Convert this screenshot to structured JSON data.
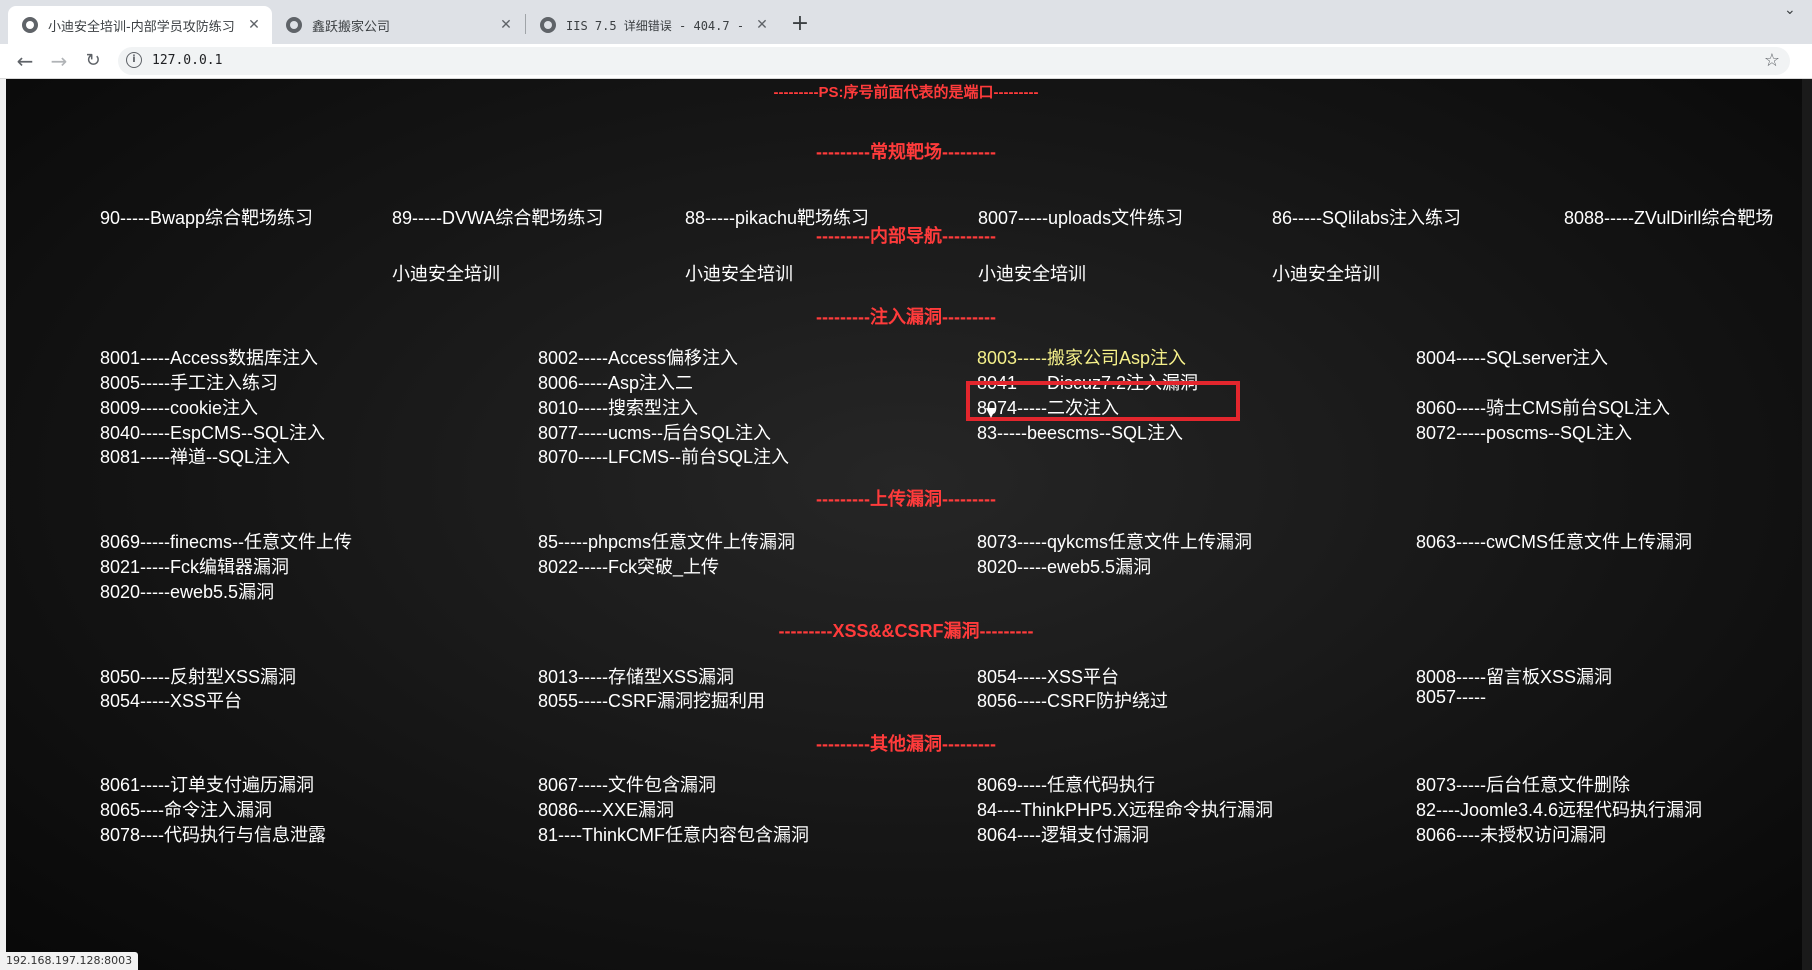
{
  "browser": {
    "tabs": [
      {
        "title": "小迪安全培训-内部学员攻防练习",
        "active": true
      },
      {
        "title": "鑫跃搬家公司",
        "active": false
      },
      {
        "title": "IIS 7.5 详细错误 - 404.7 - Not Found",
        "active": false
      }
    ],
    "new_tab_label": "+",
    "url": "127.0.0.1",
    "status_url": "192.168.197.128:8003",
    "icons": {
      "back": "arrow-left-icon",
      "forward": "arrow-right-icon",
      "reload": "reload-icon",
      "info": "info-icon",
      "bookmark": "star-icon"
    }
  },
  "page": {
    "ps_note": "---------PS:序号前面代表的是端口---------",
    "sections": [
      {
        "title": "---------常规靶场---------",
        "items": [
          "90-----Bwapp综合靶场练习",
          "89-----DVWA综合靶场练习",
          "88-----pikachu靶场练习",
          "8007-----uploads文件练习",
          "86-----SQlilabs注入练习",
          "8088-----ZVulDirll综合靶场"
        ]
      },
      {
        "title": "---------内部导航---------",
        "items": [
          "小迪安全培训",
          "小迪安全培训",
          "小迪安全培训",
          "小迪安全培训"
        ]
      },
      {
        "title": "---------注入漏洞---------",
        "rows": [
          [
            "8001-----Access数据库注入",
            "8002-----Access偏移注入",
            "8003-----搬家公司Asp注入",
            "8004-----SQLserver注入"
          ],
          [
            "8005-----手工注入练习",
            "8006-----Asp注入二",
            "8041-----Discuz7.2注入漏洞"
          ],
          [
            "8009-----cookie注入",
            "8010-----搜索型注入",
            "8074-----二次注入",
            "8060-----骑士CMS前台SQL注入"
          ],
          [
            "8040-----EspCMS--SQL注入",
            "8077-----ucms--后台SQL注入",
            "83-----beescms--SQL注入",
            "8072-----poscms--SQL注入"
          ],
          [
            "8081-----禅道--SQL注入",
            "8070-----LFCMS--前台SQL注入"
          ]
        ]
      },
      {
        "title": "---------上传漏洞---------",
        "rows": [
          [
            "8069-----finecms--任意文件上传",
            "85-----phpcms任意文件上传漏洞",
            "8073-----qykcms任意文件上传漏洞",
            "8063-----cwCMS任意文件上传漏洞"
          ],
          [
            "8021-----Fck编辑器漏洞",
            "8022-----Fck突破_上传",
            "8020-----eweb5.5漏洞"
          ],
          [
            "8020-----eweb5.5漏洞"
          ]
        ]
      },
      {
        "title": "---------XSS&&CSRF漏洞---------",
        "rows": [
          [
            "8050-----反射型XSS漏洞",
            "8013-----存储型XSS漏洞",
            "8054-----XSS平台",
            "8008-----留言板XSS漏洞"
          ],
          [
            "8054-----XSS平台",
            "8055-----CSRF漏洞挖掘利用",
            "8056-----CSRF防护绕过",
            "8057-----"
          ]
        ]
      },
      {
        "title": "---------其他漏洞---------",
        "rows": [
          [
            "8061-----订单支付遍历漏洞",
            "8067-----文件包含漏洞",
            "8069-----任意代码执行",
            "8073-----后台任意文件删除"
          ],
          [
            "8065----命令注入漏洞",
            "8086----XXE漏洞",
            "84----ThinkPHP5.X远程命令执行漏洞",
            "82----Joomle3.4.6远程代码执行漏洞"
          ],
          [
            "8078----代码执行与信息泄露",
            "81----ThinkCMF任意内容包含漏洞",
            "8064----逻辑支付漏洞",
            "8066----未授权访问漏洞"
          ]
        ]
      }
    ]
  },
  "colors": {
    "heading": "#ff3b3b",
    "link": "#ffffff",
    "hover_link": "#f5f08a",
    "highlight_box": "#e3262d",
    "background": "#111111"
  }
}
